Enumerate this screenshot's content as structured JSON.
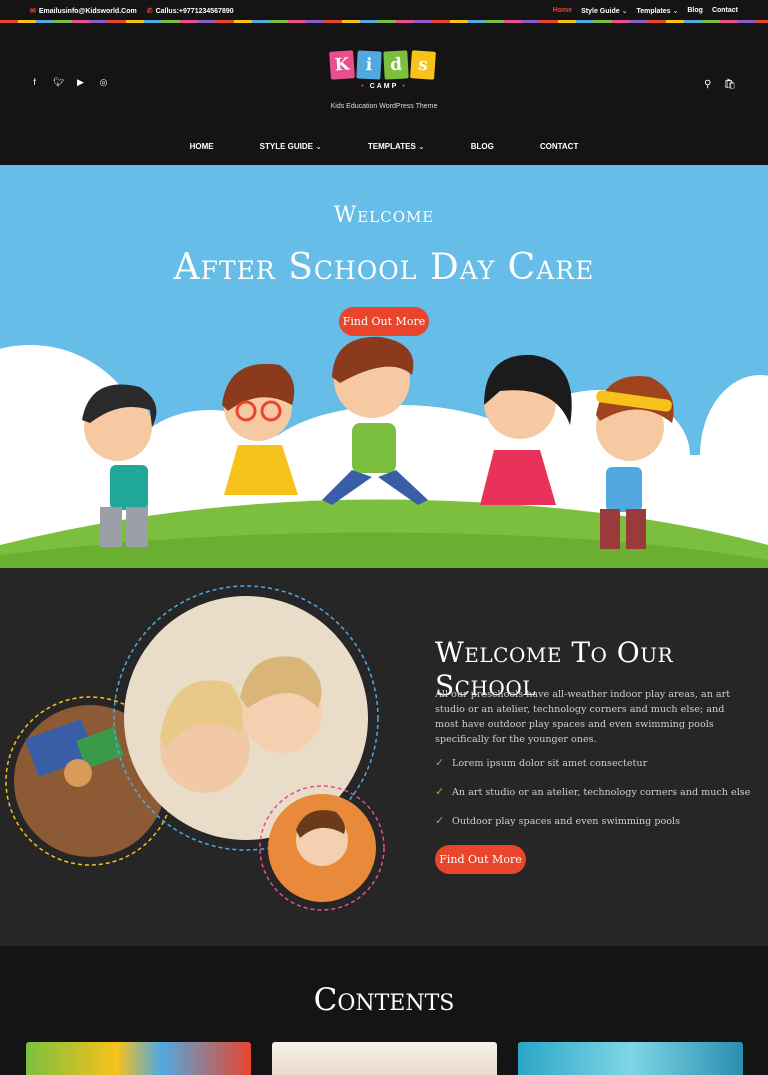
{
  "topbar": {
    "email": "Emailusinfo@Kidsworld.Com",
    "phone": "Callus:+9771234567890",
    "links": [
      "Home",
      "Style Guide",
      "Templates",
      "Blog",
      "Contact"
    ]
  },
  "header": {
    "logo_letters": [
      "K",
      "i",
      "d",
      "s"
    ],
    "logo_sub": "CAMP",
    "tagline": "Kids Education WordPress Theme",
    "social_icons": [
      "facebook-icon",
      "twitter-icon",
      "youtube-icon",
      "instagram-icon"
    ],
    "nav": [
      "HOME",
      "STYLE GUIDE",
      "TEMPLATES",
      "BLOG",
      "CONTACT"
    ]
  },
  "hero": {
    "welcome": "Welcome",
    "title": "After School Day Care",
    "button": "Find Out More"
  },
  "about": {
    "title": "Welcome To Our School",
    "paragraph": "All our preschools have all-weather indoor play areas, an art studio or an atelier, technology corners and much else; and most have outdoor play spaces and even swimming pools specifically for the younger ones.",
    "features": [
      "Lorem ipsum dolor sit amet consectetur",
      "An art studio or an atelier, technology corners and much else",
      "Outdoor play spaces and even swimming pools"
    ],
    "button": "Find Out More"
  },
  "contents": {
    "title": "Contents"
  },
  "colors": {
    "accent": "#e8452c",
    "sky": "#66bde8",
    "grass": "#7cbf3f",
    "dark": "#141414",
    "logo_tiles": [
      "#e74f8d",
      "#52a9e0",
      "#7cbf3f",
      "#f7c21b"
    ]
  }
}
